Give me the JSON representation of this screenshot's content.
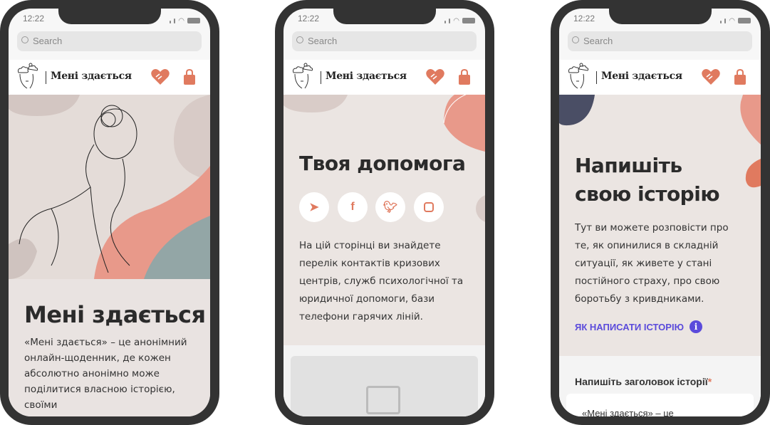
{
  "status": {
    "time": "12:22"
  },
  "search": {
    "placeholder": "Search"
  },
  "header": {
    "brand": "Мені здається"
  },
  "screens": [
    {
      "title": "Мені здається",
      "body": [
        "«Мені здається» – це анонімний",
        "онлайн-щоденник, де кожен",
        "абсолютно анонімно може",
        "поділитися власною історією,",
        "своїми"
      ]
    },
    {
      "title": "Твоя допомога",
      "social": [
        "telegram",
        "facebook",
        "twitter",
        "instagram"
      ],
      "body": [
        "На цій сторінці ви знайдете",
        "перелік контактів кризових",
        "центрів, служб психологічної та",
        "юридичної допомоги, бази",
        "телефони гарячих ліній."
      ]
    },
    {
      "title": [
        "Напишіть",
        "свою історію"
      ],
      "body": [
        "Тут ви можете розповісти про",
        "те, як опинилися в складній",
        "ситуації, як живете у стані",
        "постійного страху, про свою",
        "боротьбу з кривдниками."
      ],
      "link": "ЯК НАПИСАТИ ІСТОРІЮ",
      "field_label": "Напишіть заголовок історії",
      "required": "*",
      "field_value": "«Мені здається» – це"
    }
  ],
  "colors": {
    "accent": "#e07a5f",
    "link": "#5b4bdb",
    "frame": "#333333",
    "bg": "#ebe5e2"
  }
}
